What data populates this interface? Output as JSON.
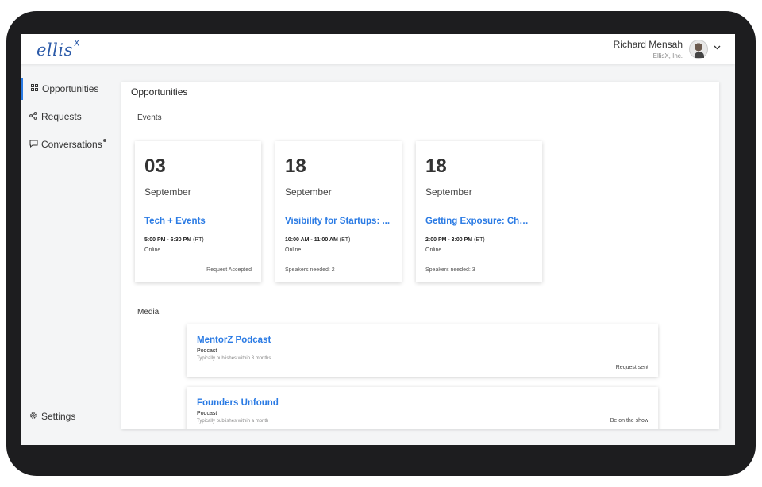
{
  "app": {
    "logo": "ellis",
    "logo_sup": "X"
  },
  "user": {
    "name": "Richard Mensah",
    "org": "EllisX, Inc."
  },
  "sidebar": {
    "items": [
      {
        "label": "Opportunities",
        "icon": "grid-icon",
        "active": true
      },
      {
        "label": "Requests",
        "icon": "share-icon"
      },
      {
        "label": "Conversations",
        "icon": "chat-icon",
        "badge": true
      }
    ],
    "settings": {
      "label": "Settings",
      "icon": "gear-icon"
    }
  },
  "main": {
    "title": "Opportunities",
    "events_label": "Events",
    "media_label": "Media",
    "events": [
      {
        "day": "03",
        "month": "September",
        "title": "Tech + Events",
        "time": "5:00 PM - 6:30 PM",
        "tz": "(PT)",
        "location": "Online",
        "footer": "Request Accepted",
        "footer_align": "right"
      },
      {
        "day": "18",
        "month": "September",
        "title": "Visibility for Startups: ...",
        "time": "10:00 AM - 11:00 AM",
        "tz": "(ET)",
        "location": "Online",
        "footer": "Speakers needed: 2",
        "footer_align": "left"
      },
      {
        "day": "18",
        "month": "September",
        "title": "Getting Exposure: Chall...",
        "time": "2:00 PM - 3:00 PM",
        "tz": "(ET)",
        "location": "Online",
        "footer": "Speakers needed: 3",
        "footer_align": "left"
      }
    ],
    "media": [
      {
        "title": "MentorZ Podcast",
        "type": "Podcast",
        "note": "Typically publishes within 3 months",
        "status": "Request sent"
      },
      {
        "title": "Founders Unfound",
        "type": "Podcast",
        "note": "Typically publishes within a month",
        "status": "Be on the show"
      }
    ]
  },
  "colors": {
    "accent": "#2b7be4",
    "logo": "#2b5aa8",
    "frame": "#1d1d1f"
  }
}
